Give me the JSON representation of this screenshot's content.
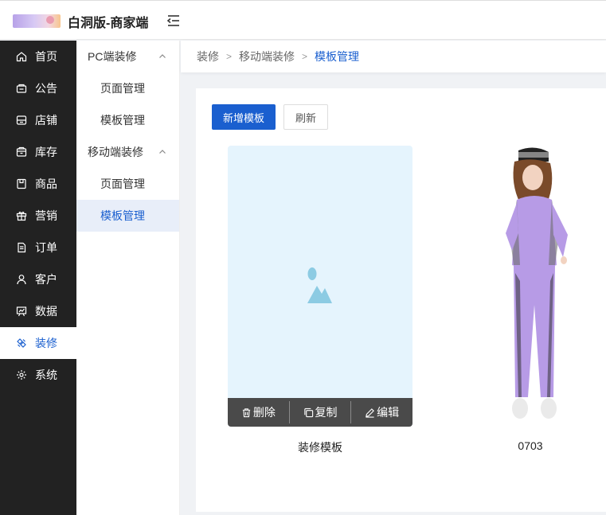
{
  "header": {
    "app_title": "白洞版-商家端"
  },
  "sidebar": {
    "items": [
      {
        "label": "首页",
        "icon": "home-icon"
      },
      {
        "label": "公告",
        "icon": "notice-icon"
      },
      {
        "label": "店铺",
        "icon": "store-icon"
      },
      {
        "label": "库存",
        "icon": "inventory-icon"
      },
      {
        "label": "商品",
        "icon": "product-icon"
      },
      {
        "label": "营销",
        "icon": "gift-icon"
      },
      {
        "label": "订单",
        "icon": "order-icon"
      },
      {
        "label": "客户",
        "icon": "user-icon"
      },
      {
        "label": "数据",
        "icon": "chart-icon"
      },
      {
        "label": "装修",
        "icon": "decorate-icon",
        "active": true
      },
      {
        "label": "系统",
        "icon": "gear-icon"
      }
    ]
  },
  "subnav": {
    "groups": [
      {
        "label": "PC端装修",
        "items": [
          {
            "label": "页面管理"
          },
          {
            "label": "模板管理"
          }
        ]
      },
      {
        "label": "移动端装修",
        "items": [
          {
            "label": "页面管理"
          },
          {
            "label": "模板管理",
            "active": true
          }
        ]
      }
    ]
  },
  "breadcrumb": [
    "装修",
    "移动端装修",
    "模板管理"
  ],
  "toolbar": {
    "add_label": "新增模板",
    "refresh_label": "刷新"
  },
  "templates": [
    {
      "name": "装修模板",
      "actions": {
        "delete": "删除",
        "copy": "复制",
        "edit": "编辑"
      }
    },
    {
      "name": "0703"
    }
  ],
  "colors": {
    "primary": "#1a5fcf",
    "sidebar_bg": "#222222",
    "card_bg": "#e5f4fd"
  }
}
